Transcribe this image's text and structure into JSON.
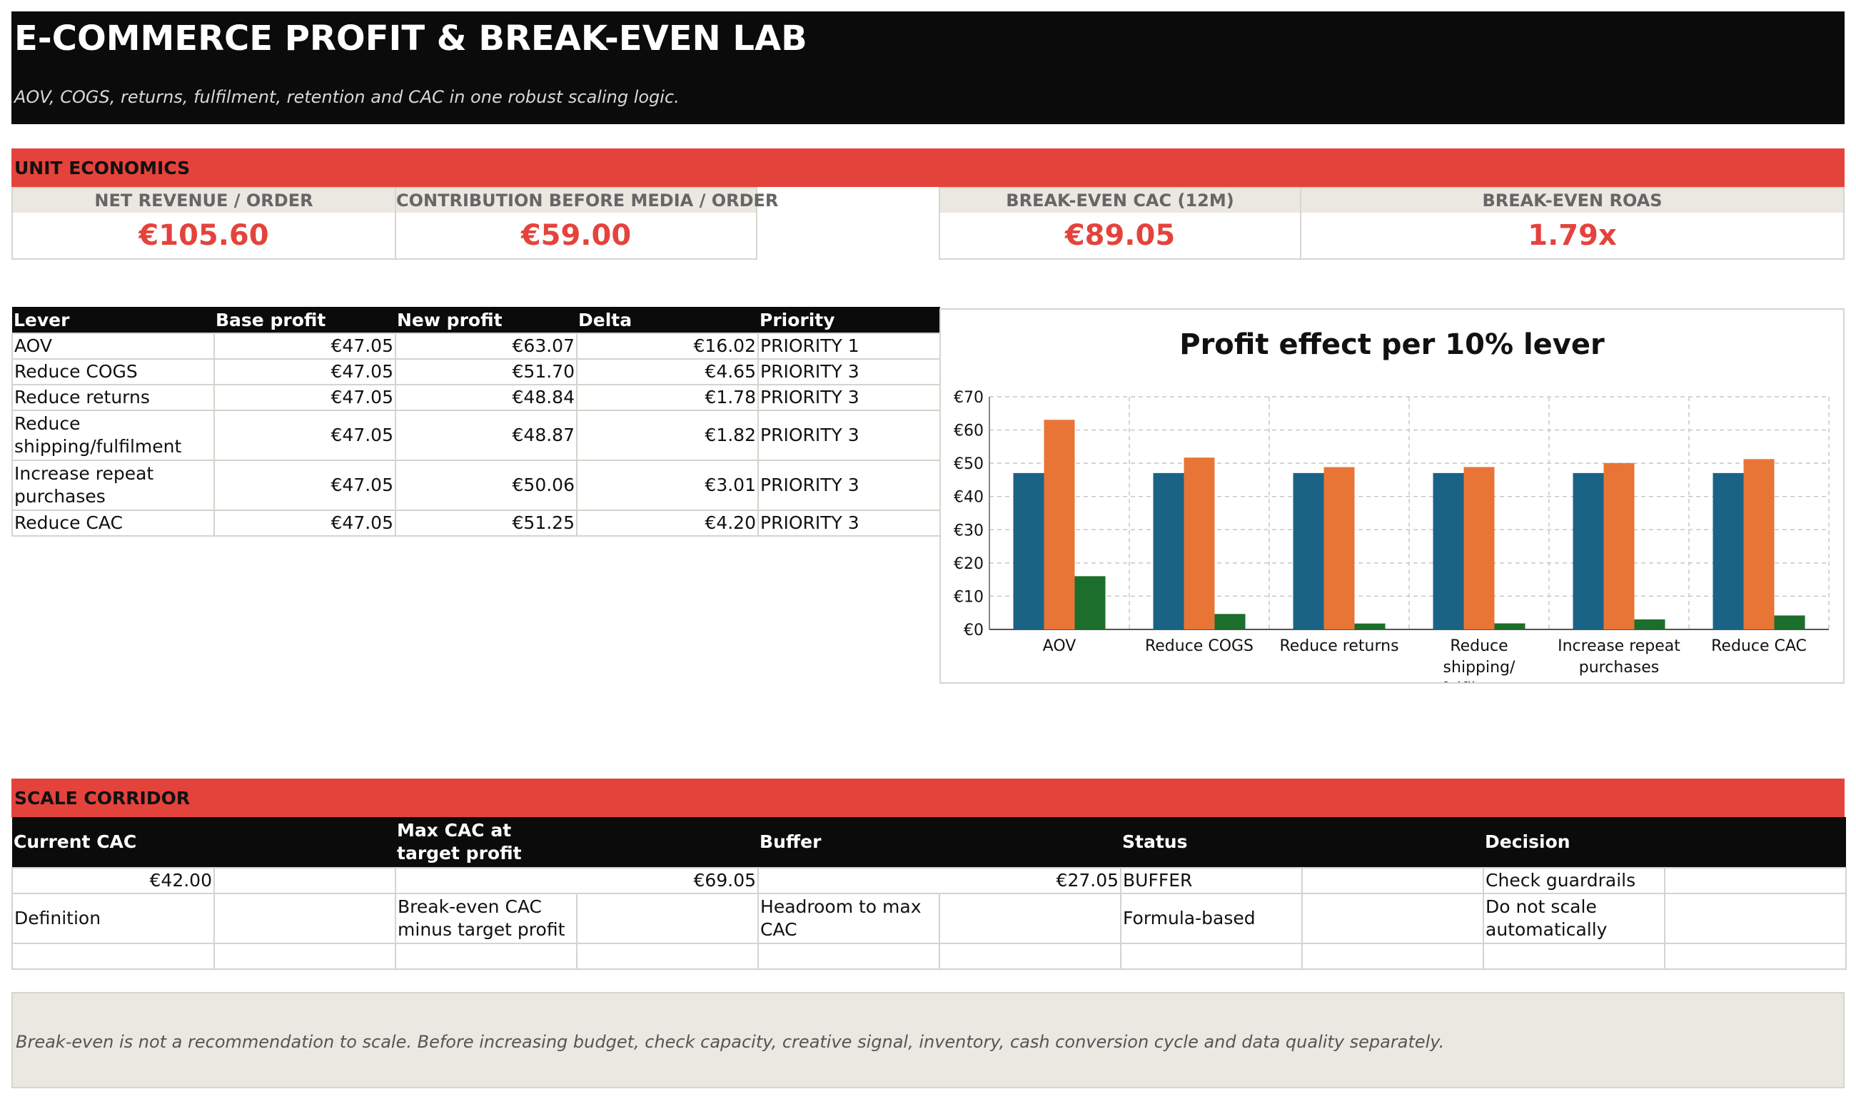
{
  "header": {
    "title": "E-COMMERCE PROFIT & BREAK-EVEN LAB",
    "subtitle": "AOV, COGS, returns, fulfilment, retention and CAC in one robust scaling logic."
  },
  "unit_economics": {
    "section_label": "UNIT ECONOMICS",
    "kpis": [
      {
        "label": "NET REVENUE / ORDER",
        "value": "€105.60"
      },
      {
        "label": "CONTRIBUTION BEFORE MEDIA / ORDER",
        "value": "€59.00"
      },
      {
        "label": "BREAK-EVEN CAC (12M)",
        "value": "€89.05"
      },
      {
        "label": "BREAK-EVEN ROAS",
        "value": "1.79x"
      }
    ]
  },
  "levers": {
    "headers": [
      "Lever",
      "Base profit",
      "New profit",
      "Delta",
      "Priority"
    ],
    "rows": [
      {
        "lever": "AOV",
        "base": "€47.05",
        "new": "€63.07",
        "delta": "€16.02",
        "priority": "PRIORITY 1"
      },
      {
        "lever": "Reduce COGS",
        "base": "€47.05",
        "new": "€51.70",
        "delta": "€4.65",
        "priority": "PRIORITY 3"
      },
      {
        "lever": "Reduce returns",
        "base": "€47.05",
        "new": "€48.84",
        "delta": "€1.78",
        "priority": "PRIORITY 3"
      },
      {
        "lever": "Reduce shipping/fulfilment",
        "base": "€47.05",
        "new": "€48.87",
        "delta": "€1.82",
        "priority": "PRIORITY 3"
      },
      {
        "lever": "Increase repeat purchases",
        "base": "€47.05",
        "new": "€50.06",
        "delta": "€3.01",
        "priority": "PRIORITY 3"
      },
      {
        "lever": "Reduce CAC",
        "base": "€47.05",
        "new": "€51.25",
        "delta": "€4.20",
        "priority": "PRIORITY 3"
      }
    ]
  },
  "chart_data": {
    "type": "bar",
    "title": "Profit effect per 10% lever",
    "categories": [
      [
        "AOV"
      ],
      [
        "Reduce COGS"
      ],
      [
        "Reduce returns"
      ],
      [
        "Reduce",
        "shipping/",
        "fulfilment"
      ],
      [
        "Increase repeat",
        "purchases"
      ],
      [
        "Reduce CAC"
      ]
    ],
    "series": [
      {
        "values": [
          47.05,
          47.05,
          47.05,
          47.05,
          47.05,
          47.05
        ],
        "color": "#1a6385"
      },
      {
        "values": [
          63.07,
          51.7,
          48.84,
          48.87,
          50.06,
          51.25
        ],
        "color": "#e87535"
      },
      {
        "values": [
          16.02,
          4.65,
          1.78,
          1.82,
          3.01,
          4.2
        ],
        "color": "#1b6e2b"
      }
    ],
    "ylim": [
      0,
      70
    ],
    "yticks": [
      "€0",
      "€10",
      "€20",
      "€30",
      "€40",
      "€50",
      "€60",
      "€70"
    ],
    "grid": true,
    "legend": "none"
  },
  "scale_corridor": {
    "section_label": "SCALE CORRIDOR",
    "headers": [
      "Current CAC",
      "Max CAC at target profit",
      "Buffer",
      "Status",
      "Decision"
    ],
    "row1": {
      "current_cac": "€42.00",
      "max_cac": "€69.05",
      "buffer": "€27.05",
      "status": "BUFFER",
      "decision": "Check guardrails"
    },
    "row2": {
      "definition": "Definition",
      "max_cac_def": "Break-even CAC minus target profit",
      "buffer_def": "Headroom to max CAC",
      "status_def": "Formula-based",
      "decision_def": "Do not scale automatically"
    }
  },
  "note": {
    "text": "Break-even is not a recommendation to scale. Before increasing budget, check capacity, creative signal, inventory, cash conversion cycle and data quality separately."
  }
}
